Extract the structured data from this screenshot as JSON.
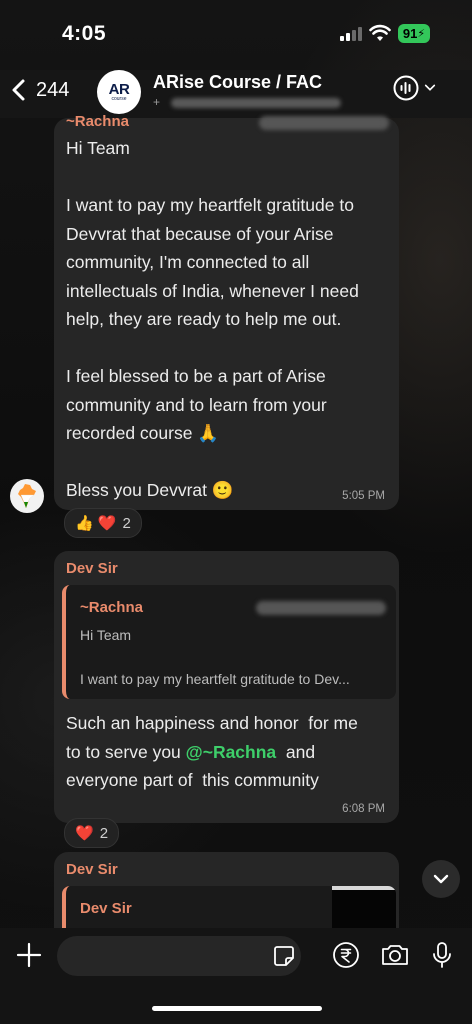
{
  "status_bar": {
    "time": "4:05",
    "battery": "91"
  },
  "header": {
    "back_count": "244",
    "title": "ARise Course / FAC",
    "subtitle_prefix": "+",
    "avatar_text": "AR",
    "avatar_sub": "course"
  },
  "messages": [
    {
      "sender": "~Rachna",
      "text": "Hi Team\n\nI want to pay my heartfelt gratitude to\nDevvrat that because of your Arise\ncommunity, I'm connected to all\nintellectuals of India, whenever I need\nhelp, they are ready to help me out.\n\nI feel blessed to be a part of Arise\ncommunity and to learn from your\nrecorded course 🙏\n\nBless you Devvrat 🙂",
      "time": "5:05 PM",
      "reactions": {
        "emojis": "👍 ❤️",
        "count": "2"
      }
    },
    {
      "sender": "Dev Sir",
      "quote": {
        "sender": "~Rachna",
        "line1": "Hi Team",
        "line2": "I want to pay my heartfelt gratitude to Dev..."
      },
      "text_before": "Such an happiness and honor  for me\nto to serve you ",
      "mention": "@~Rachna",
      "text_after": "  and\neveryone part of  this community",
      "time": "6:08 PM",
      "reactions": {
        "emojis": "❤️",
        "count": "2"
      }
    },
    {
      "sender": "Dev Sir",
      "quote": {
        "sender": "Dev Sir"
      }
    }
  ],
  "colors": {
    "sender": "#e98b6c",
    "mention": "#3ecf6a",
    "battery": "#33c75a"
  },
  "icons": [
    "chevron-left-icon",
    "voice-call-icon",
    "chevron-down-icon",
    "plus-icon",
    "sticker-icon",
    "rupee-icon",
    "camera-icon",
    "microphone-icon"
  ]
}
